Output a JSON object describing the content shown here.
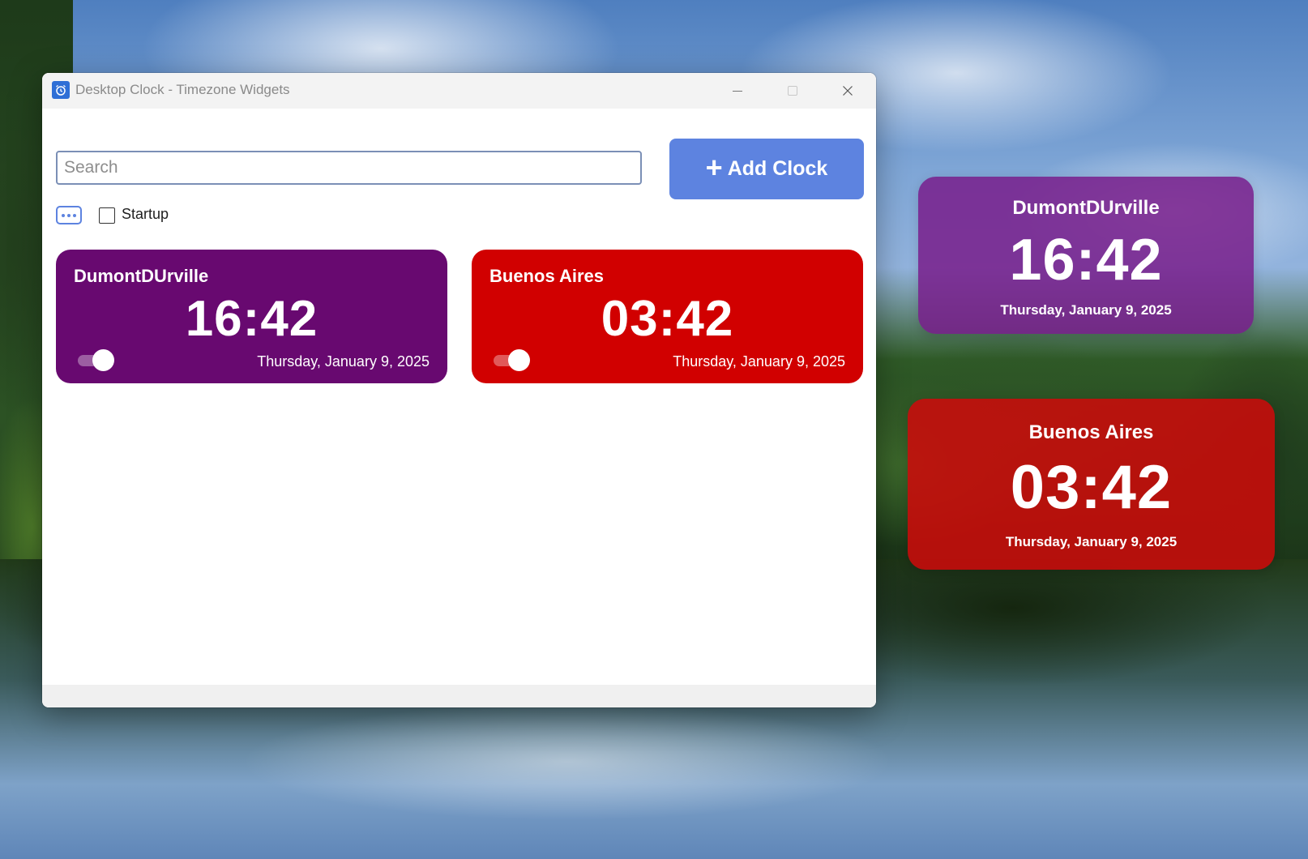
{
  "window": {
    "title": "Desktop Clock - Timezone Widgets",
    "icon": "alarm-clock-icon",
    "controls": {
      "minimize_icon": "minimize-icon",
      "maximize_icon": "maximize-icon",
      "close_icon": "close-icon"
    }
  },
  "toolbar": {
    "search_placeholder": "Search",
    "search_value": "",
    "add_button_label": "Add Clock",
    "add_button_icon": "+",
    "more_icon": "more-options-icon",
    "startup_label": "Startup",
    "startup_checked": false
  },
  "clocks": [
    {
      "city": "DumontDUrville",
      "time": "16:42",
      "date": "Thursday, January 9, 2025",
      "enabled": true,
      "color": "#680970"
    },
    {
      "city": "Buenos Aires",
      "time": "03:42",
      "date": "Thursday, January 9, 2025",
      "enabled": true,
      "color": "#d10000"
    }
  ],
  "widgets": [
    {
      "city": "DumontDUrville",
      "time": "16:42",
      "date": "Thursday, January 9, 2025",
      "color": "#781e8c"
    },
    {
      "city": "Buenos Aires",
      "time": "03:42",
      "date": "Thursday, January 9, 2025",
      "color": "#cd0a0a"
    }
  ],
  "colors": {
    "accent": "#5d83e0",
    "titlebar": "#f3f3f3"
  }
}
